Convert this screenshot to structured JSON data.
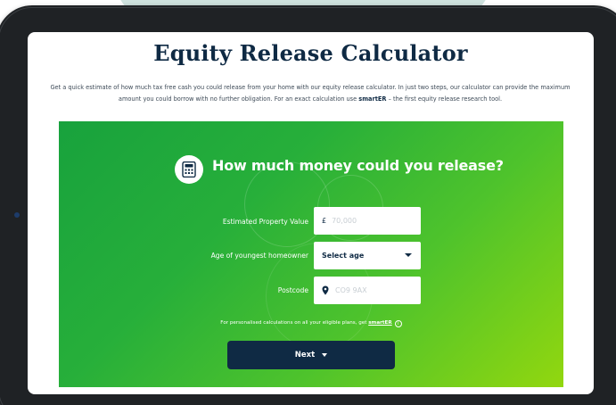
{
  "page": {
    "title": "Equity Release Calculator",
    "intro_part1": "Get a quick estimate of how much tax free cash you could release from your home with our equity release calculator. In just two steps, our calculator can provide the maximum amount you could borrow with no further obligation. For an exact calculation use ",
    "intro_link": "smartER",
    "intro_part2": " – the first equity release research tool."
  },
  "calculator": {
    "heading": "How much money could you release?",
    "icon": "calculator-icon",
    "fields": {
      "property_value": {
        "label": "Estimated Property Value",
        "prefix": "£",
        "placeholder": "70,000",
        "value": ""
      },
      "age": {
        "label": "Age of youngest homeowner",
        "value": "Select age"
      },
      "postcode": {
        "label": "Postcode",
        "placeholder": "CO9 9AX",
        "value": "",
        "icon": "location-pin-icon"
      }
    },
    "note_text": "For personalised calculations on all your eligible plans, get ",
    "note_link": "smartER",
    "info_glyph": "i",
    "next_label": "Next"
  },
  "colors": {
    "navy": "#0f2a44",
    "green_start": "#18a23d",
    "green_end": "#92d70f",
    "placeholder": "#c8ced3"
  }
}
